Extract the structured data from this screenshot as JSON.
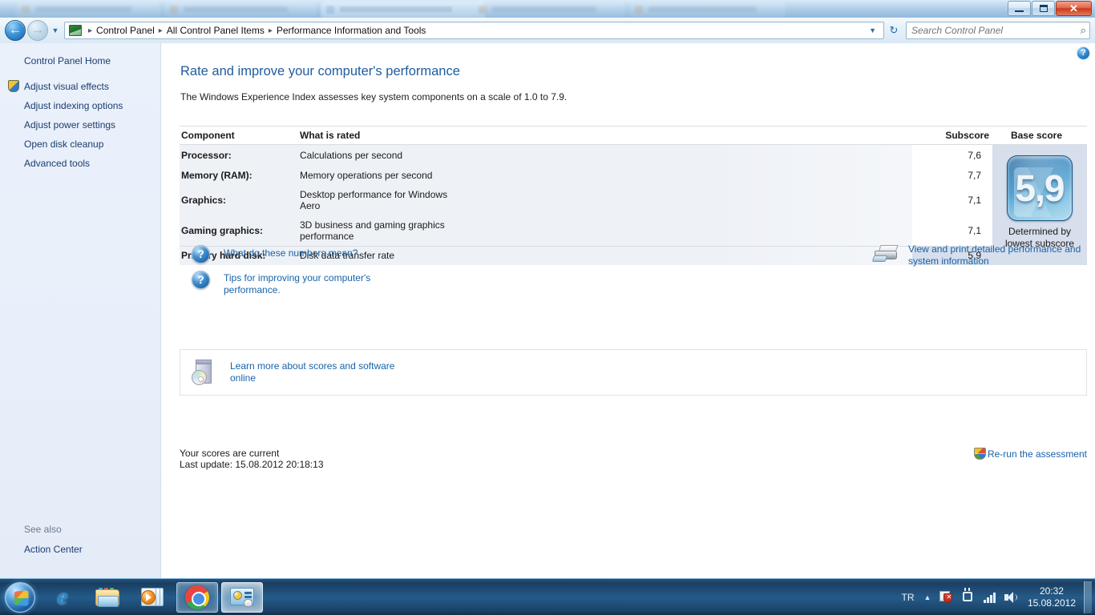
{
  "window": {
    "title": "Performance Information and Tools",
    "controls": {
      "minimize": "minimize",
      "restore": "restore",
      "close": "✕"
    }
  },
  "addressbar": {
    "back_icon": "←",
    "forward_icon": "→",
    "history_icon": "▼",
    "breadcrumb": [
      "Control Panel",
      "All Control Panel Items",
      "Performance Information and Tools"
    ],
    "separator": "▸",
    "chevron_icon": "▼",
    "refresh_icon": "↻",
    "search_placeholder": "Search Control Panel",
    "search_value": "",
    "search_icon": "⌕"
  },
  "sidebar": {
    "home_label": "Control Panel Home",
    "items": [
      {
        "label": "Adjust visual effects",
        "shield": true
      },
      {
        "label": "Adjust indexing options",
        "shield": false
      },
      {
        "label": "Adjust power settings",
        "shield": false
      },
      {
        "label": "Open disk cleanup",
        "shield": false
      },
      {
        "label": "Advanced tools",
        "shield": false
      }
    ],
    "see_also_label": "See also",
    "see_also_items": [
      "Action Center"
    ]
  },
  "content": {
    "help_icon": "?",
    "title": "Rate and improve your computer's performance",
    "subtitle": "The Windows Experience Index assesses key system components on a scale of 1.0 to 7.9.",
    "table": {
      "headers": {
        "component": "Component",
        "what_is_rated": "What is rated",
        "subscore": "Subscore",
        "base_score": "Base score"
      },
      "rows": [
        {
          "component": "Processor:",
          "what": "Calculations per second",
          "subscore": "7,6",
          "lowest": false
        },
        {
          "component": "Memory (RAM):",
          "what": "Memory operations per second",
          "subscore": "7,7",
          "lowest": false
        },
        {
          "component": "Graphics:",
          "what": "Desktop performance for Windows\nAero",
          "subscore": "7,1",
          "lowest": false
        },
        {
          "component": "Gaming graphics:",
          "what": "3D business and gaming graphics\nperformance",
          "subscore": "7,1",
          "lowest": false
        },
        {
          "component": "Primary hard disk:",
          "what": "Disk data transfer rate",
          "subscore": "5,9",
          "lowest": true
        }
      ],
      "base_score": {
        "value": "5,9",
        "caption": "Determined by\nlowest subscore"
      }
    },
    "links": [
      {
        "label": "What do these numbers mean?",
        "icon": "question-icon"
      },
      {
        "label": "Tips for improving your computer's\nperformance.",
        "icon": "question-icon"
      }
    ],
    "print_link": {
      "label": "View and print detailed performance and\nsystem information",
      "icon": "printer-icon"
    },
    "learn_more": {
      "label": "Learn more about scores and software\nonline",
      "icon": "software-cd-icon"
    },
    "status": {
      "current": "Your scores are current",
      "last_update": "Last update: 15.08.2012 20:18:13",
      "rerun_label": "Re-run the assessment"
    }
  },
  "taskbar": {
    "start_label": "Start",
    "buttons": [
      {
        "name": "internet-explorer",
        "state": "normal"
      },
      {
        "name": "windows-explorer",
        "state": "normal"
      },
      {
        "name": "windows-media-player",
        "state": "normal"
      },
      {
        "name": "google-chrome",
        "state": "active"
      },
      {
        "name": "control-panel",
        "state": "focused"
      }
    ],
    "tray": {
      "language": "TR",
      "arrow_icon": "▲",
      "icons": [
        "action-center-icon",
        "network-icon",
        "signal-icon",
        "volume-icon"
      ],
      "time": "20:32",
      "date": "15.08.2012"
    }
  },
  "colors": {
    "accent_link": "#1763a8",
    "title_blue": "#1f5c9e",
    "sidebar_bg": "#e8effa",
    "base_panel_bg": "#d7deec",
    "row_bg": "#eef1f6",
    "close_button": "#c93a1d"
  }
}
